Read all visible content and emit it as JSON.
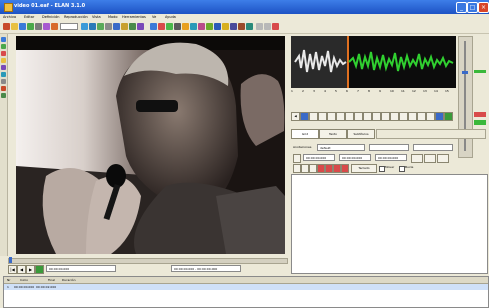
{
  "window": {
    "title": "video 01.eaf - ELAN 3.1.0"
  },
  "menubar": {
    "items": [
      "Archivo",
      "Editar",
      "Definición",
      "Reproducción",
      "Vista",
      "Modo",
      "Herramientas",
      "Ve",
      "Ayuda"
    ]
  },
  "media": {
    "current_time": "00:00:00.000",
    "selection_label": "00:00:00.000 - 00:00:00.000"
  },
  "waveform": {
    "ruler_ticks": [
      "1",
      "2",
      "3",
      "4",
      "5",
      "6",
      "7",
      "8",
      "9",
      "10",
      "11",
      "12",
      "13",
      "14",
      "15"
    ]
  },
  "right_panel": {
    "tabs": [
      "Grid",
      "Texto",
      "Subtítulos"
    ],
    "tier_label": "Anotaciones",
    "tier_value": "default",
    "field_left": "00:00:00.000",
    "field_mid": "00:00:00.000",
    "field_right": "00:00:00.000",
    "keyboard_label": "Teclado",
    "checkbox_a": "Mover",
    "checkbox_b": "Bucle"
  },
  "bottom_list": {
    "headers": [
      "Nr",
      "Inicio",
      "Final",
      "Duración"
    ],
    "row_values": [
      "1",
      "00:00:00.000",
      "00:00:02.000"
    ]
  }
}
